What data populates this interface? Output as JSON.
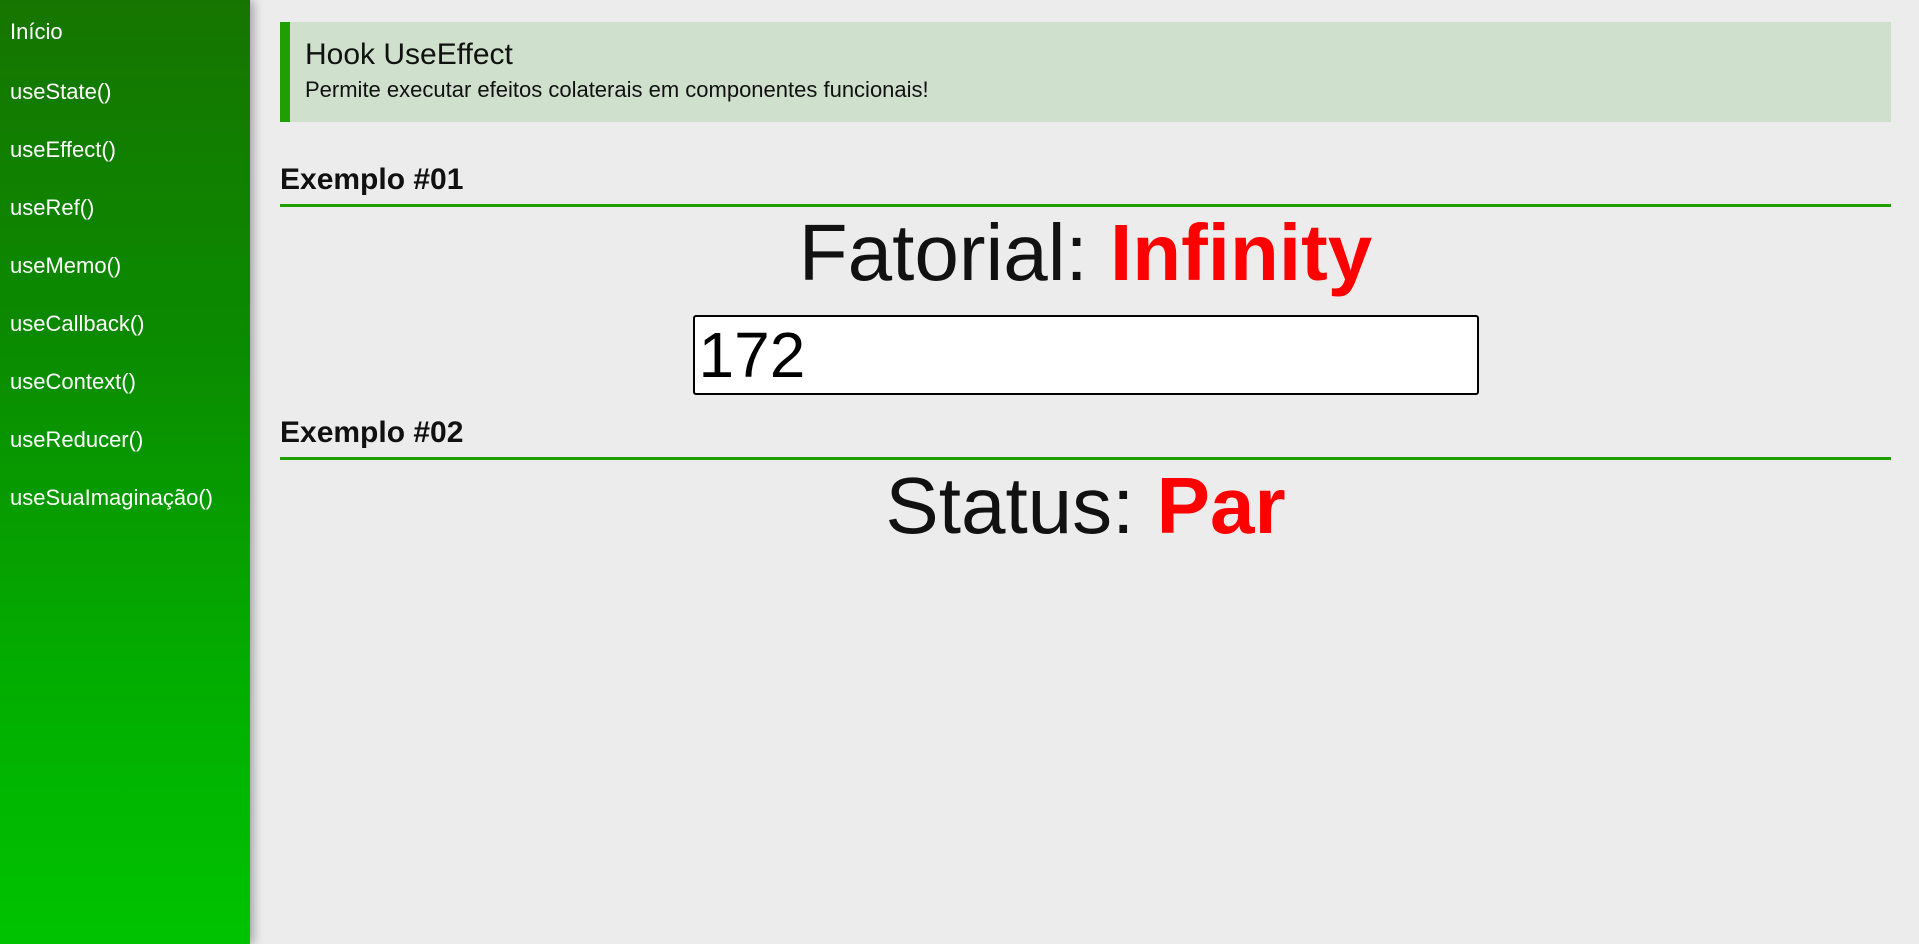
{
  "sidebar": {
    "items": [
      {
        "label": "Início"
      },
      {
        "label": "useState()"
      },
      {
        "label": "useEffect()"
      },
      {
        "label": "useRef()"
      },
      {
        "label": "useMemo()"
      },
      {
        "label": "useCallback()"
      },
      {
        "label": "useContext()"
      },
      {
        "label": "useReducer()"
      },
      {
        "label": "useSuaImaginação()"
      }
    ]
  },
  "header": {
    "title": "Hook UseEffect",
    "subtitle": "Permite executar efeitos colaterais em componentes funcionais!"
  },
  "sections": [
    {
      "title": "Exemplo #01",
      "display_label": "Fatorial: ",
      "display_value": "Infinity",
      "input_value": "172"
    },
    {
      "title": "Exemplo #02",
      "display_label": "Status: ",
      "display_value": "Par"
    }
  ],
  "colors": {
    "accent": "#1f9f00",
    "value": "#ff0000",
    "header_bg": "#cfe0cc",
    "sidebar_top": "#167500",
    "sidebar_bottom": "#00c300"
  }
}
